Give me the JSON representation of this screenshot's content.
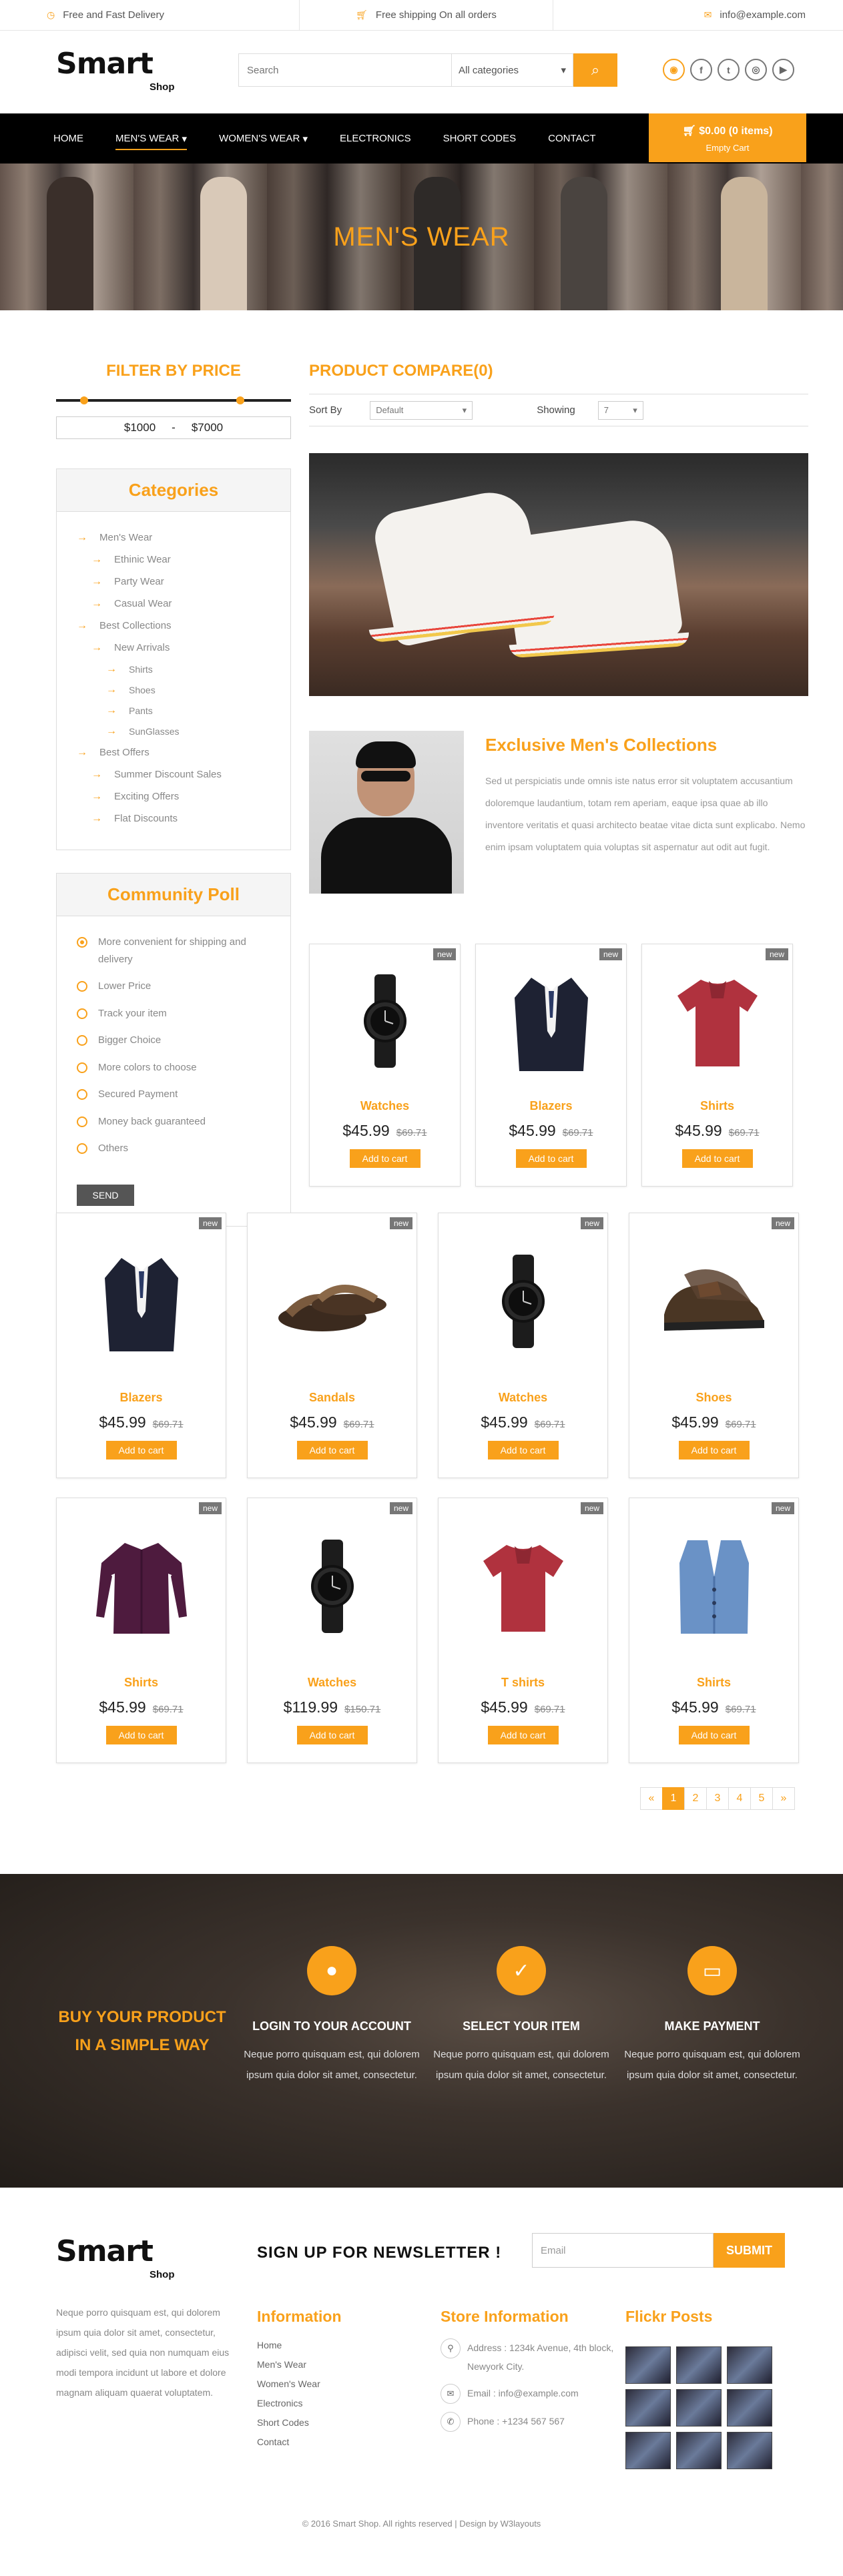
{
  "topbar": {
    "delivery": "Free and Fast Delivery",
    "shipping": "Free shipping On all orders",
    "email": "info@example.com"
  },
  "brand": {
    "logo_main": "Smart",
    "logo_sub": "Shop"
  },
  "search": {
    "placeholder": "Search",
    "category": "All categories"
  },
  "nav": {
    "items": [
      "HOME",
      "MEN'S WEAR",
      "WOMEN'S WEAR",
      "ELECTRONICS",
      "SHORT CODES",
      "CONTACT"
    ],
    "cart_total": "$0.00 (0 items)",
    "cart_empty": "Empty Cart"
  },
  "banner": {
    "title": "MEN'S WEAR"
  },
  "filter": {
    "title": "FILTER BY PRICE",
    "min": "$1000",
    "sep": "-",
    "max": "$7000"
  },
  "categories": {
    "title": "Categories",
    "items": [
      "Men's Wear",
      "Ethinic Wear",
      "Party Wear",
      "Casual Wear",
      "Best Collections",
      "New Arrivals",
      "Shirts",
      "Shoes",
      "Pants",
      "SunGlasses",
      "Best Offers",
      "Summer Discount Sales",
      "Exciting Offers",
      "Flat Discounts"
    ]
  },
  "poll": {
    "title": "Community Poll",
    "options": [
      "More convenient for shipping and delivery",
      "Lower Price",
      "Track your item",
      "Bigger Choice",
      "More colors to choose",
      "Secured Payment",
      "Money back guaranteed",
      "Others"
    ],
    "send": "SEND"
  },
  "compare": {
    "title": "PRODUCT COMPARE(0)",
    "sort_label": "Sort By",
    "sort_value": "Default",
    "show_label": "Showing",
    "show_value": "7"
  },
  "exclusive": {
    "title": "Exclusive Men's Collections",
    "body": "Sed ut perspiciatis unde omnis iste natus error sit voluptatem accusantium doloremque laudantium, totam rem aperiam, eaque ipsa quae ab illo inventore veritatis et quasi architecto beatae vitae dicta sunt explicabo. Nemo enim ipsam voluptatem quia voluptas sit aspernatur aut odit aut fugit."
  },
  "products": [
    {
      "name": "Watches",
      "price": "$45.99",
      "old": "$69.71",
      "badge": "new",
      "btn": "Add to cart",
      "icon": "watch-icon"
    },
    {
      "name": "Blazers",
      "price": "$45.99",
      "old": "$69.71",
      "badge": "new",
      "btn": "Add to cart",
      "icon": "blazer-icon"
    },
    {
      "name": "Shirts",
      "price": "$45.99",
      "old": "$69.71",
      "badge": "new",
      "btn": "Add to cart",
      "icon": "tshirt-icon"
    },
    {
      "name": "Blazers",
      "price": "$45.99",
      "old": "$69.71",
      "badge": "new",
      "btn": "Add to cart",
      "icon": "blazer-icon"
    },
    {
      "name": "Sandals",
      "price": "$45.99",
      "old": "$69.71",
      "badge": "new",
      "btn": "Add to cart",
      "icon": "sandal-icon"
    },
    {
      "name": "Watches",
      "price": "$45.99",
      "old": "$69.71",
      "badge": "new",
      "btn": "Add to cart",
      "icon": "watch-icon"
    },
    {
      "name": "Shoes",
      "price": "$45.99",
      "old": "$69.71",
      "badge": "new",
      "btn": "Add to cart",
      "icon": "shoe-icon"
    },
    {
      "name": "Shirts",
      "price": "$45.99",
      "old": "$69.71",
      "badge": "new",
      "btn": "Add to cart",
      "icon": "shirt-icon"
    },
    {
      "name": "Watches",
      "price": "$119.99",
      "old": "$150.71",
      "badge": "new",
      "btn": "Add to cart",
      "icon": "watch-icon"
    },
    {
      "name": "T shirts",
      "price": "$45.99",
      "old": "$69.71",
      "badge": "new",
      "btn": "Add to cart",
      "icon": "tshirt-icon"
    },
    {
      "name": "Shirts",
      "price": "$45.99",
      "old": "$69.71",
      "badge": "new",
      "btn": "Add to cart",
      "icon": "vest-icon"
    }
  ],
  "pager": [
    "«",
    "1",
    "2",
    "3",
    "4",
    "5",
    "»"
  ],
  "steps": {
    "headline_1": "BUY YOUR PRODUCT",
    "headline_2": "IN A SIMPLE WAY",
    "items": [
      {
        "title": "LOGIN TO YOUR ACCOUNT",
        "desc": "Neque porro quisquam est, qui dolorem ipsum quia dolor sit amet, consectetur."
      },
      {
        "title": "SELECT YOUR ITEM",
        "desc": "Neque porro quisquam est, qui dolorem ipsum quia dolor sit amet, consectetur."
      },
      {
        "title": "MAKE PAYMENT",
        "desc": "Neque porro quisquam est, qui dolorem ipsum quia dolor sit amet, consectetur."
      }
    ]
  },
  "footer": {
    "newsletter": "SIGN UP FOR NEWSLETTER !",
    "email_placeholder": "Email",
    "submit": "SUBMIT",
    "about": "Neque porro quisquam est, qui dolorem ipsum quia dolor sit amet, consectetur, adipisci velit, sed quia non numquam eius modi tempora incidunt ut labore et dolore magnam aliquam quaerat voluptatem.",
    "info_title": "Information",
    "info_links": [
      "Home",
      "Men's Wear",
      "Women's Wear",
      "Electronics",
      "Short Codes",
      "Contact"
    ],
    "store_title": "Store Information",
    "address": "Address : 1234k Avenue, 4th block, Newyork City.",
    "email": "Email : info@example.com",
    "phone": "Phone : +1234 567 567",
    "flickr_title": "Flickr Posts",
    "copyright": "© 2016 Smart Shop. All rights reserved | Design by W3layouts"
  },
  "colors": {
    "accent": "#f9a11b",
    "nav": "#000000"
  }
}
